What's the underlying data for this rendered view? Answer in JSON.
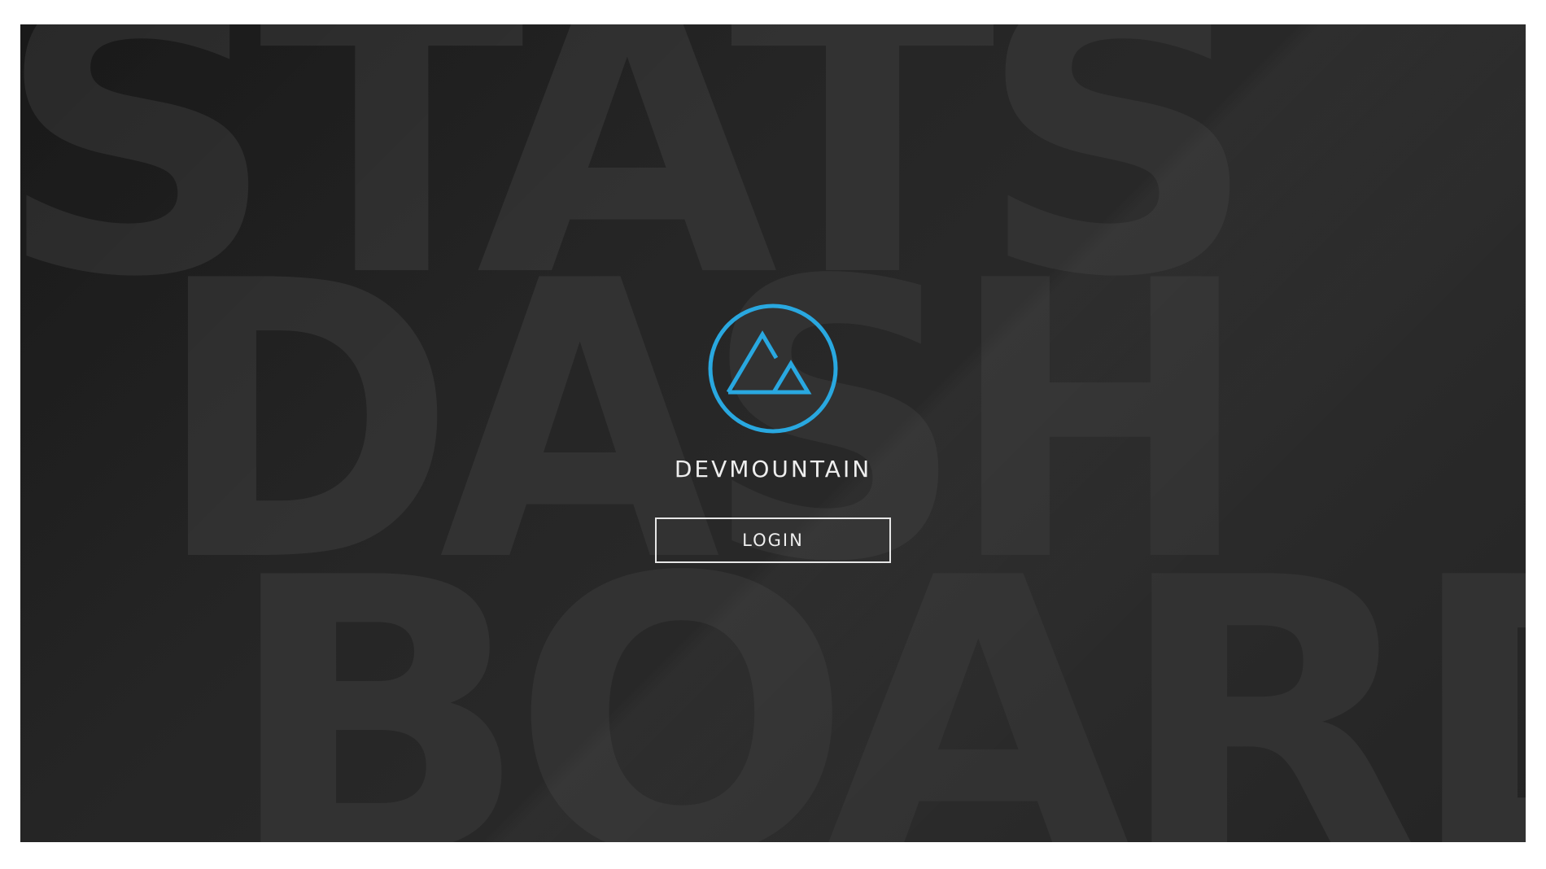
{
  "background": {
    "words": [
      "STATS",
      "DASH",
      "BOARD"
    ]
  },
  "brand": {
    "name": "DEVMOUNTAIN",
    "logo_icon": "mountain-circle-icon",
    "accent_color": "#29a8e0"
  },
  "login": {
    "label": "LOGIN"
  }
}
